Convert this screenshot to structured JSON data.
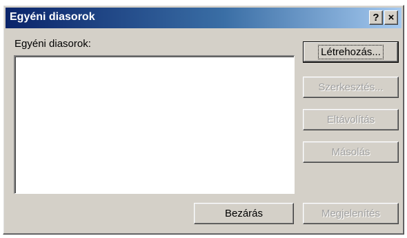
{
  "window": {
    "title": "Egyéni diasorok",
    "help_label": "?",
    "close_label": "×"
  },
  "list": {
    "label": "Egyéni diasorok:",
    "items": []
  },
  "buttons": {
    "create": "Létrehozás...",
    "edit": "Szerkesztés...",
    "remove": "Eltávolítás",
    "copy": "Másolás",
    "close": "Bezárás",
    "show": "Megjelenítés"
  }
}
